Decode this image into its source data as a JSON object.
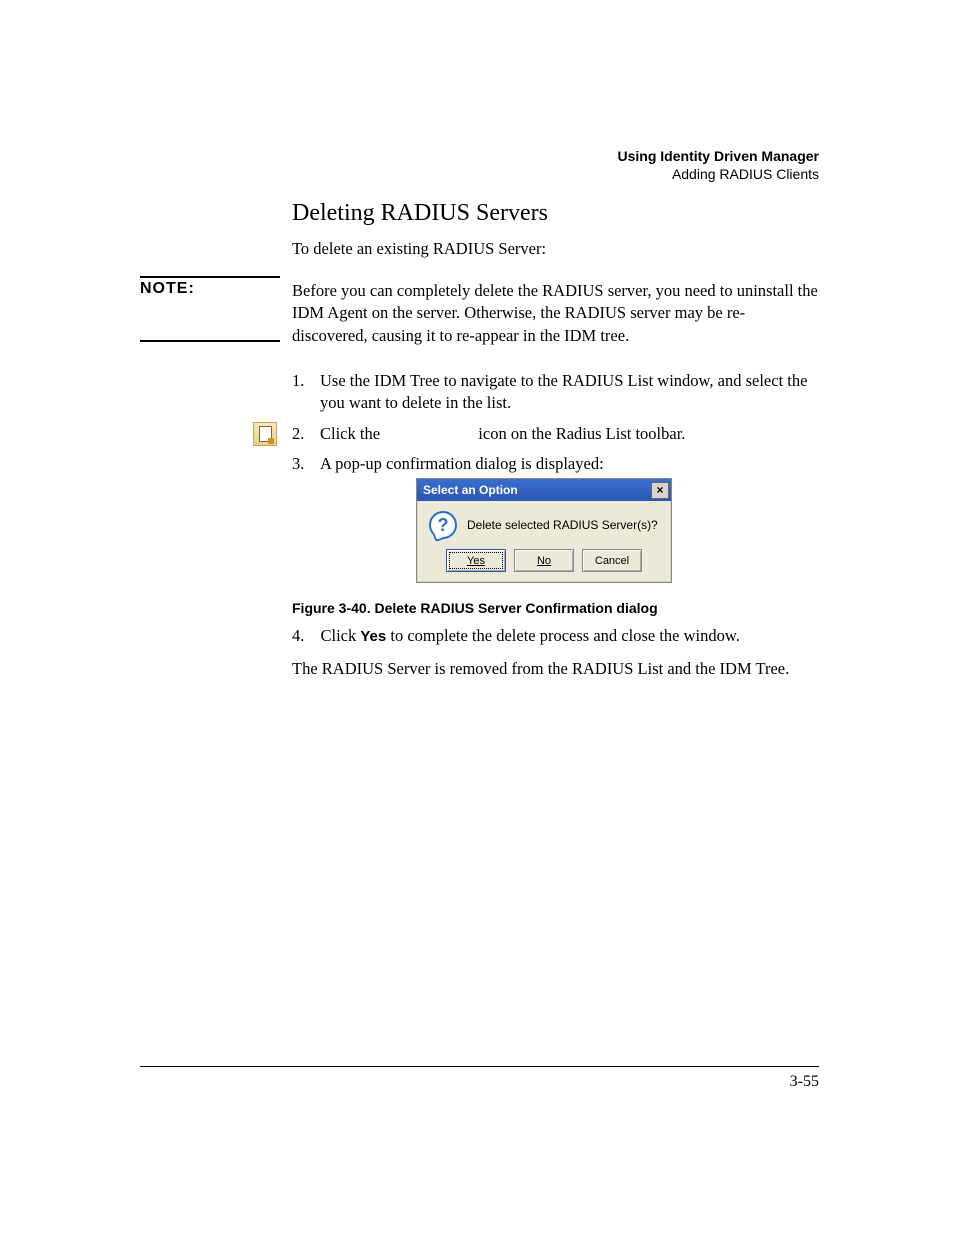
{
  "header": {
    "chapter": "Using Identity Driven Manager",
    "section": "Adding RADIUS Clients"
  },
  "title": "Deleting RADIUS Servers",
  "intro": "To delete an existing RADIUS Server:",
  "note": {
    "label": "NOTE:",
    "text": "Before you can completely delete the RADIUS server, you need to uninstall the IDM Agent on the server. Otherwise, the RADIUS server may be re-discovered, causing it to re-appear in the IDM tree."
  },
  "steps": {
    "s1_num": "1.",
    "s1": "Use the IDM Tree to navigate to the RADIUS List window, and select the you want to delete in the list.",
    "s2_num": "2.",
    "s2_a": "Click the ",
    "s2_b": " icon on the Radius List toolbar.",
    "s3_num": "3.",
    "s3": "A pop-up confirmation dialog is displayed:",
    "s4_num": "4.",
    "s4_a": "Click ",
    "s4_bold": "Yes",
    "s4_b": " to complete the delete process and close the window."
  },
  "dialog": {
    "title": "Select an Option",
    "close_glyph": "×",
    "question_glyph": "?",
    "message": "Delete selected RADIUS Server(s)?",
    "yes": "Yes",
    "no": "No",
    "cancel": "Cancel"
  },
  "figure_caption": "Figure 3-40. Delete RADIUS Server Confirmation dialog",
  "closing": "The RADIUS Server is removed from the RADIUS List and the IDM Tree.",
  "page_number": "3-55"
}
